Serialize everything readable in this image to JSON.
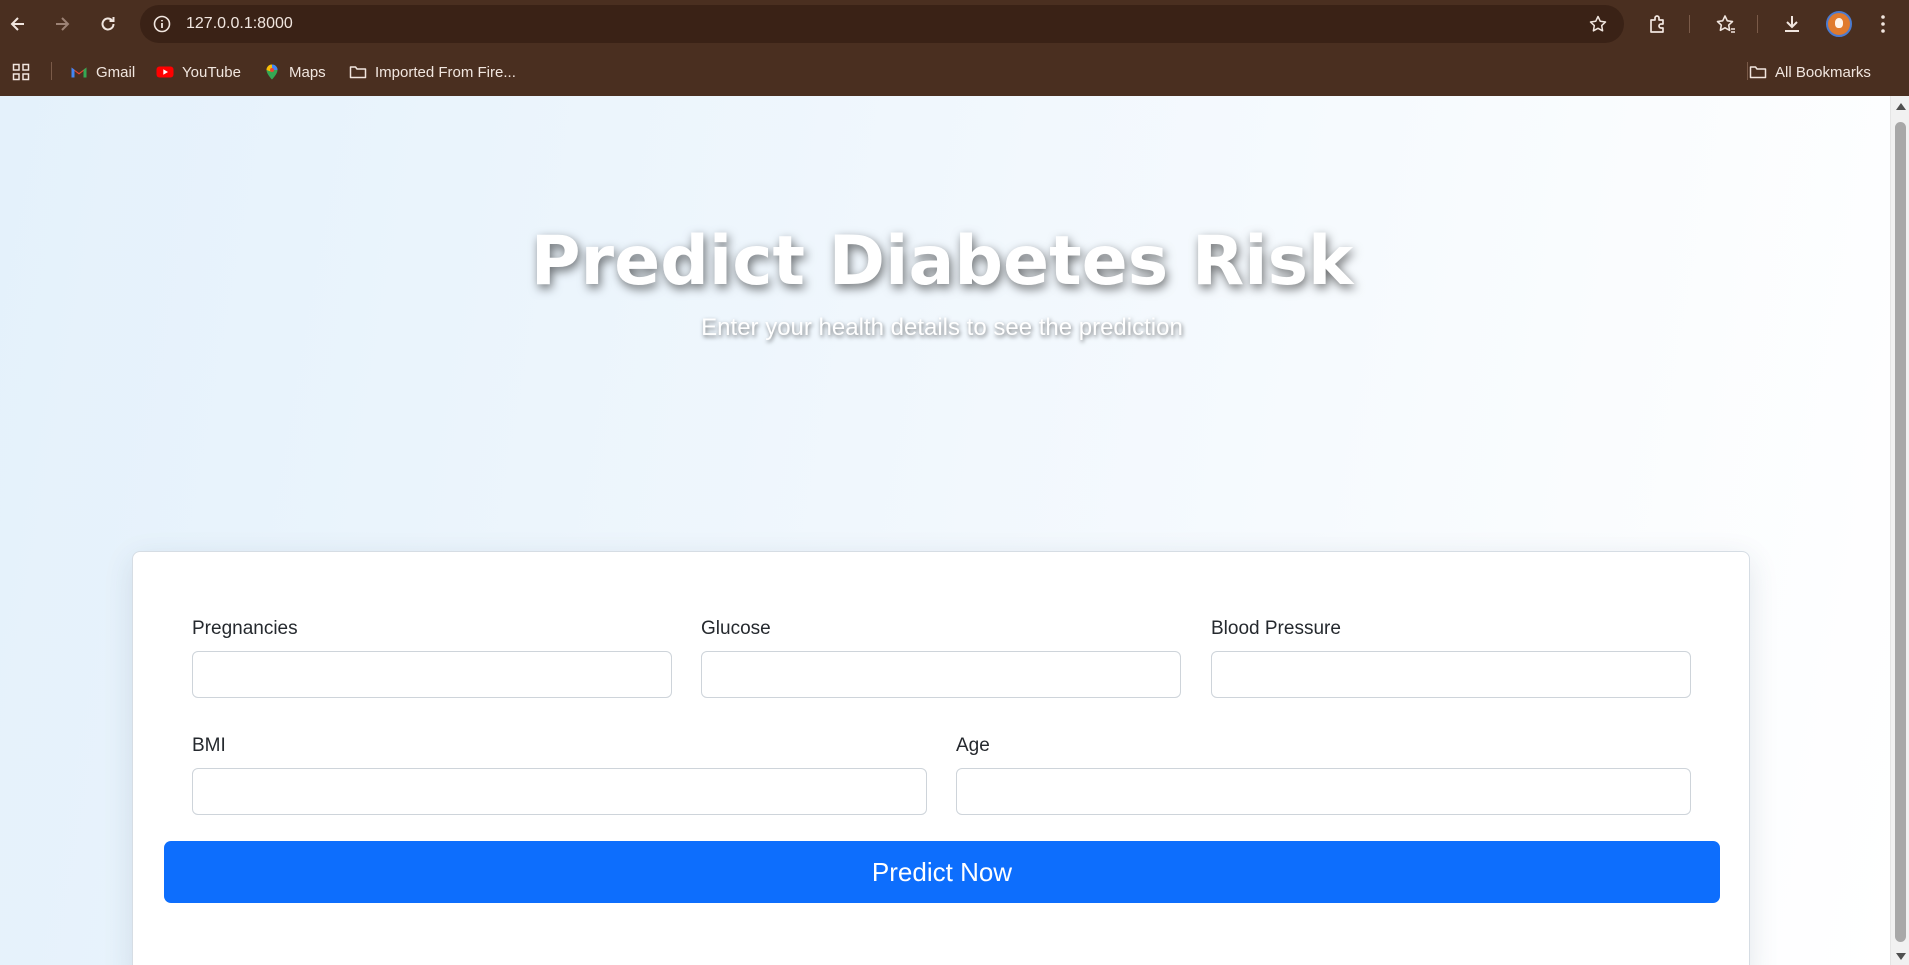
{
  "browser": {
    "url": "127.0.0.1:8000",
    "bookmarks": [
      {
        "label": "Gmail",
        "icon": "gmail-icon"
      },
      {
        "label": "YouTube",
        "icon": "youtube-icon"
      },
      {
        "label": "Maps",
        "icon": "maps-icon"
      },
      {
        "label": "Imported From Fire...",
        "icon": "folder-icon"
      }
    ],
    "all_bookmarks_label": "All Bookmarks",
    "colors": {
      "frame": "#4a2f20",
      "omnibox": "#3a2216"
    }
  },
  "hero": {
    "title": "Predict Diabetes Risk",
    "subtitle": "Enter your health details to see the prediction"
  },
  "form": {
    "fields": [
      {
        "label": "Pregnancies",
        "value": ""
      },
      {
        "label": "Glucose",
        "value": ""
      },
      {
        "label": "Blood Pressure",
        "value": ""
      },
      {
        "label": "BMI",
        "value": ""
      },
      {
        "label": "Age",
        "value": ""
      }
    ],
    "submit_label": "Predict Now",
    "colors": {
      "button": "#0d6efd"
    }
  }
}
